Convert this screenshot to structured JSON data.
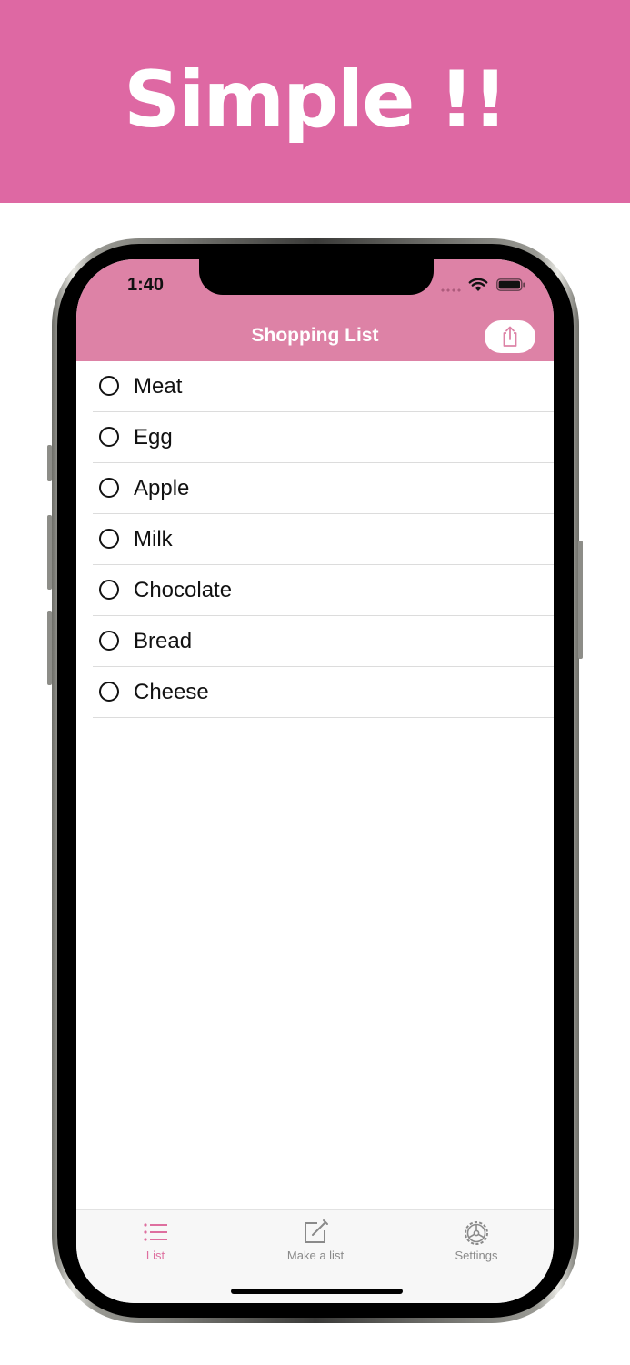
{
  "banner": {
    "title": "Simple !!",
    "color": "#de68a3"
  },
  "status_bar": {
    "time": "1:40"
  },
  "nav": {
    "title": "Shopping List",
    "share_icon": "share-icon",
    "color": "#dd82a6"
  },
  "list": {
    "items": [
      {
        "label": "Meat",
        "checked": false
      },
      {
        "label": "Egg",
        "checked": false
      },
      {
        "label": "Apple",
        "checked": false
      },
      {
        "label": "Milk",
        "checked": false
      },
      {
        "label": "Chocolate",
        "checked": false
      },
      {
        "label": "Bread",
        "checked": false
      },
      {
        "label": "Cheese",
        "checked": false
      }
    ]
  },
  "tabbar": {
    "active_color": "#de6f9f",
    "inactive_color": "#8a8a8a",
    "tabs": [
      {
        "label": "List",
        "icon": "list-icon",
        "active": true
      },
      {
        "label": "Make a list",
        "icon": "compose-icon",
        "active": false
      },
      {
        "label": "Settings",
        "icon": "gear-icon",
        "active": false
      }
    ]
  }
}
